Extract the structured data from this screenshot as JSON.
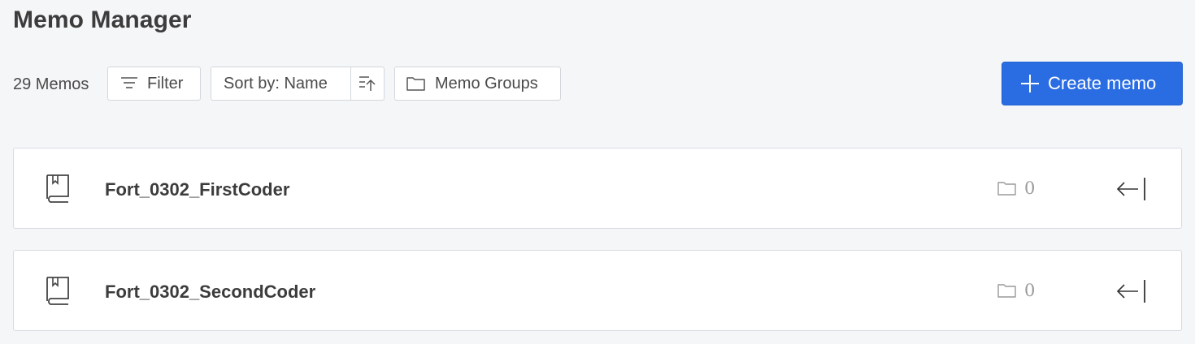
{
  "header": {
    "title": "Memo Manager"
  },
  "toolbar": {
    "count_label": "29 Memos",
    "filter_label": "Filter",
    "sort_label": "Sort by: Name",
    "groups_label": "Memo Groups",
    "create_label": "Create memo"
  },
  "icons": {
    "filter": "filter-icon",
    "sort_direction": "sort-ascending-icon",
    "folder": "folder-icon",
    "plus": "plus-icon",
    "book": "book-icon",
    "open": "arrow-left-bar-icon"
  },
  "colors": {
    "accent": "#2a6de3",
    "background": "#f5f6f8"
  },
  "memos": [
    {
      "name": "Fort_0302_FirstCoder",
      "group_count": "0"
    },
    {
      "name": "Fort_0302_SecondCoder",
      "group_count": "0"
    }
  ]
}
